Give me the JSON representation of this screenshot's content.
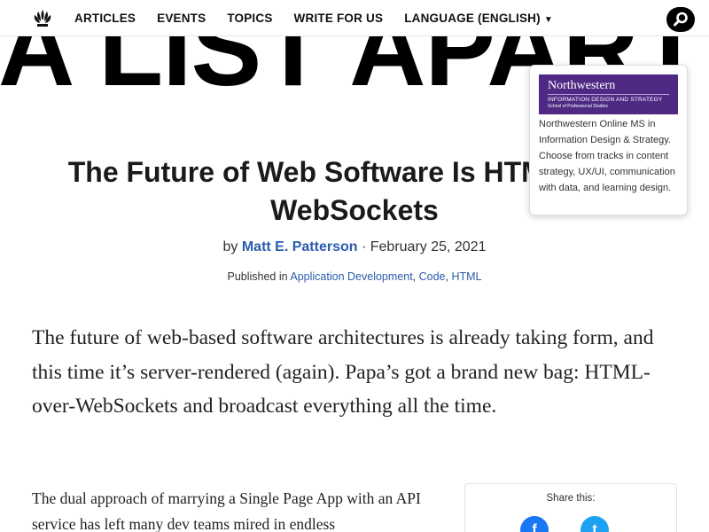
{
  "nav": {
    "logo": "a-list-apart-logo-icon",
    "items": [
      {
        "label": "ARTICLES"
      },
      {
        "label": "EVENTS"
      },
      {
        "label": "TOPICS"
      },
      {
        "label": "WRITE FOR US"
      },
      {
        "label": "LANGUAGE (ENGLISH)",
        "has_dropdown": true
      }
    ],
    "search_icon": "search-icon"
  },
  "banner": {
    "text": "A LIST APART"
  },
  "ad": {
    "brand": "Northwestern",
    "program_line": "INFORMATION DESIGN AND STRATEGY",
    "school_line": "School of Professional Studies",
    "text": "Northwestern Online MS in Information Design & Strategy. Choose from tracks in content strategy, UX/UI, communication with data, and learning design."
  },
  "article": {
    "title": "The Future of Web Software Is HTML-over-WebSockets",
    "by_prefix": "by",
    "author": "Matt E. Patterson",
    "date_sep": " · ",
    "date": "February 25, 2021",
    "published_prefix": "Published in",
    "categories": [
      "Application Development",
      "Code",
      "HTML"
    ],
    "lede": "The future of web-based software architectures is already taking form, and this time it’s server-rendered (again). Papa’s got a brand new bag: HTML-over-WebSockets and broadcast everything all the time.",
    "body": "The dual approach of marrying a Single Page App with an API service has left many dev teams mired in endless"
  },
  "share": {
    "label": "Share this:",
    "icons": [
      "facebook-icon",
      "twitter-icon"
    ]
  },
  "colors": {
    "link": "#2b5cad",
    "ad_purple": "#4e2a84",
    "facebook": "#1877f2",
    "twitter": "#1da1f2"
  }
}
